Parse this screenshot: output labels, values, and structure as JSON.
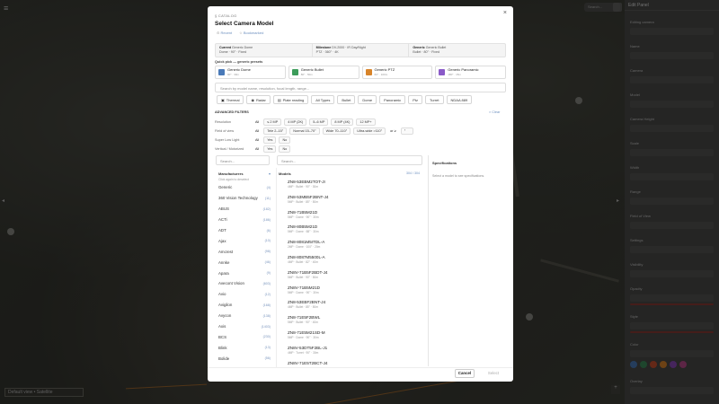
{
  "map": {
    "search_placeholder": "Search...",
    "bottom_bar_text": "Default view  •  Satellite",
    "zoom_label": "+",
    "menu_icon": "hamburger-icon"
  },
  "right_panel": {
    "title": "Edit Panel",
    "rows": [
      "Editing camera",
      "Name",
      "Camera",
      "Model",
      "Camera Height",
      "Scale",
      "Width",
      "Range",
      "Field of View",
      "Settings",
      "Visibility",
      "Opacity",
      "Style",
      "Color",
      "Overlay",
      "Background"
    ],
    "swatch_colors": [
      "#4a7ab8",
      "#3c8c5a",
      "#c8502e",
      "#d8842a",
      "#8a4ab8",
      "#b84a8a"
    ]
  },
  "modal": {
    "section": "§ CATALOG",
    "close_icon": "close-icon",
    "title": "Select Camera Model",
    "tabs": [
      {
        "label": "Recent"
      },
      {
        "label": "Bookmarked"
      }
    ],
    "current_selection": [
      {
        "label": "Current",
        "value": "Generic Dome",
        "detail": "Dome · 90° · Fixed"
      },
      {
        "label": "Milestone",
        "value": "DV-2000 · IR Day/Night",
        "detail": "PTZ · 360° · 4K"
      },
      {
        "label": "Generic",
        "value": "Generic Bullet",
        "detail": "Bullet · 80° · Fixed"
      }
    ],
    "quick_pick_label": "Quick pick — generic presets",
    "quick_picks": [
      {
        "name": "Generic Dome",
        "sub": "90° · 30m",
        "color": "#4a7ab8",
        "icon": "dome-icon"
      },
      {
        "name": "Generic Bullet",
        "sub": "80° · 50m",
        "color": "#3c9c5a",
        "icon": "bullet-icon"
      },
      {
        "name": "Generic PTZ",
        "sub": "60° · 100m",
        "color": "#d8842a",
        "icon": "ptz-icon"
      },
      {
        "name": "Generic Panoramic",
        "sub": "180° · 15m",
        "color": "#8a5ac8",
        "icon": "panoramic-icon"
      }
    ],
    "search_placeholder": "Search by model name, resolution, focal length, range...",
    "types": [
      {
        "label": "Thermal",
        "icon": "thermal-icon"
      },
      {
        "label": "Radar",
        "icon": "radar-icon"
      },
      {
        "label": "Plate reading",
        "icon": "plate-icon"
      },
      {
        "label": "All Types",
        "icon": ""
      },
      {
        "label": "Bullet",
        "icon": ""
      },
      {
        "label": "Dome",
        "icon": ""
      },
      {
        "label": "Panoramic",
        "icon": ""
      },
      {
        "label": "Ptz",
        "icon": ""
      },
      {
        "label": "Turret",
        "icon": ""
      },
      {
        "label": "NDAA 889",
        "icon": ""
      }
    ],
    "advanced_label": "ADVANCED FILTERS",
    "clear_label": "× Clear",
    "filters": [
      {
        "label": "Resolution",
        "options": [
          "All",
          "≤ 2 MP",
          "4 MP (2K)",
          "5–6 MP",
          "8 MP (4K)",
          "12 MP+"
        ]
      },
      {
        "label": "Field of view",
        "options": [
          "All",
          "Tele 2–15°",
          "Normal 15–70°",
          "Wide 70–110°",
          "Ultra-wide >110°",
          "or ≥",
          "°"
        ]
      },
      {
        "label": "Super Low Light",
        "options": [
          "All",
          "Yes",
          "No"
        ]
      },
      {
        "label": "Vertical / Motorized",
        "options": [
          "All",
          "Yes",
          "No"
        ]
      }
    ],
    "manufacturers_search": "Search...",
    "manufacturers_title": "Manufacturers",
    "manufacturers_hint": "Click again to deselect",
    "manufacturers_right": "▾",
    "manufacturers": [
      {
        "name": "Generic",
        "count": "4"
      },
      {
        "name": "360 Vision Technology",
        "count": "11"
      },
      {
        "name": "ABUS",
        "count": "182"
      },
      {
        "name": "ACTi",
        "count": "186"
      },
      {
        "name": "ADT",
        "count": "6"
      },
      {
        "name": "Ajax",
        "count": "10"
      },
      {
        "name": "Amcrest",
        "count": "98"
      },
      {
        "name": "Annke",
        "count": "46"
      },
      {
        "name": "Apara",
        "count": "9"
      },
      {
        "name": "Avecont Vision",
        "count": "603"
      },
      {
        "name": "Avio",
        "count": "12"
      },
      {
        "name": "Avigilon",
        "count": "168"
      },
      {
        "name": "Avycon",
        "count": "138"
      },
      {
        "name": "Axis",
        "count": "1403"
      },
      {
        "name": "BCS",
        "count": "230"
      },
      {
        "name": "Blink",
        "count": "13"
      },
      {
        "name": "Bolide",
        "count": "56"
      }
    ],
    "models_search": "Search...",
    "models_title": "Models",
    "models_count": "304 / 304",
    "models": [
      {
        "name": "ZN8-53EBM2TOT-JI",
        "spec": "4MP · Bullet · 90° · 30m"
      },
      {
        "name": "ZN8-53MB5F2BNT-J4",
        "spec": "5MP · Bullet · 85° · 50m"
      },
      {
        "name": "ZN8-71B5M21D",
        "spec": "5MP · Dome · 90° · 30m"
      },
      {
        "name": "ZN8-80B5M21D",
        "spec": "5MP · Dome · 88° · 30m"
      },
      {
        "name": "ZN8-8081M5ITDL-A",
        "spec": "2MP · Dome · 100° · 20m"
      },
      {
        "name": "ZN8-8087M5500L-A",
        "spec": "4MP · Bullet · 82° · 40m"
      },
      {
        "name": "ZN8V-71B5F2BDT-J4",
        "spec": "5MP · Bullet · 90° · 50m"
      },
      {
        "name": "ZN8V-71B5M21D",
        "spec": "5MP · Dome · 90° · 30m"
      },
      {
        "name": "ZN8-53EBF2BNT-J4",
        "spec": "4MP · Bullet · 85° · 50m"
      },
      {
        "name": "ZN8-71E5F2BWL",
        "spec": "5MP · Bullet · 90° · 40m"
      },
      {
        "name": "ZN8-71E5M21SD-M",
        "spec": "5MP · Dome · 90° · 30m"
      },
      {
        "name": "ZN8V-53DT5F2BL-J1",
        "spec": "4MP · Turret · 90° · 30m"
      },
      {
        "name": "ZN8V-71E5T2BCT-J4",
        "spec": "5MP · Turret · 88° · 40m"
      }
    ],
    "specs_title": "Specifications",
    "specs_hint": "Select a model to see specifications.",
    "cancel_label": "Cancel",
    "select_label": "Select"
  }
}
